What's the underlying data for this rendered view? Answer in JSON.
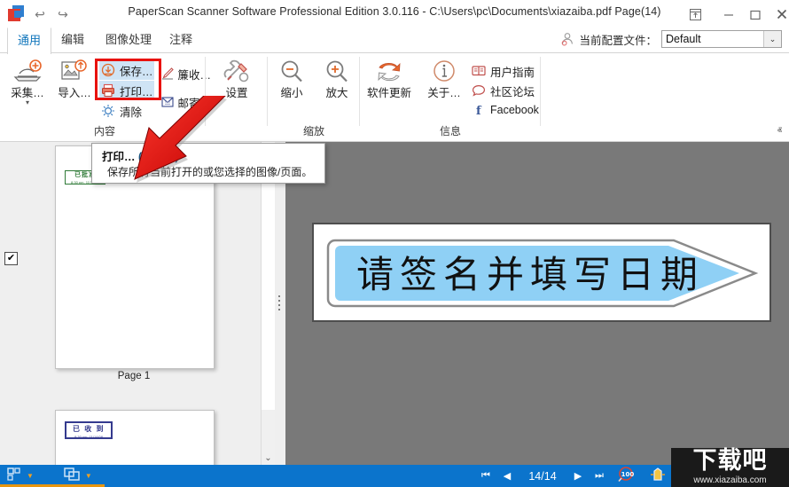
{
  "window": {
    "title": "PaperScan Scanner Software Professional Edition 3.0.116 - C:\\Users\\pc\\Documents\\xiazaiba.pdf Page(14)",
    "app_icon": "paperscan-logo",
    "quick_access": [
      {
        "name": "undo",
        "glyph": "↩"
      },
      {
        "name": "redo",
        "glyph": "↪"
      }
    ],
    "controls": {
      "ribbon_options": "⤒",
      "minimize": "–",
      "maximize": "☐",
      "close": "✕"
    }
  },
  "tabs": [
    {
      "label": "通用",
      "active": true
    },
    {
      "label": "编辑",
      "active": false
    },
    {
      "label": "图像处理",
      "active": false
    },
    {
      "label": "注释",
      "active": false
    }
  ],
  "profile": {
    "icon": "user-profile-icon",
    "label": "当前配置文件：",
    "value": "Default",
    "dropdown_glyph": "⌄"
  },
  "ribbon": {
    "collapse_glyph": "ⱏ",
    "groups": [
      {
        "name": "content",
        "label": "内容",
        "big_buttons": [
          {
            "name": "acquire",
            "label": "采集…",
            "icon": "scanner-plus-icon",
            "has_menu": true
          },
          {
            "name": "import",
            "label": "导入…",
            "icon": "import-image-icon",
            "has_menu": false
          }
        ],
        "small_buttons": [
          {
            "name": "save",
            "label": "保存…",
            "icon": "save-down-arrow-icon",
            "highlighted": false
          },
          {
            "name": "print",
            "label": "打印…",
            "icon": "printer-icon",
            "highlighted": true
          },
          {
            "name": "clear",
            "label": "清除",
            "icon": "clear-icon",
            "highlighted": false
          },
          {
            "name": "sign",
            "label": "簾收…",
            "icon": "pen-sign-icon",
            "highlighted": false
          },
          {
            "name": "mail",
            "label": "邮寄…",
            "icon": "mail-icon",
            "highlighted": false
          }
        ]
      },
      {
        "name": "settings",
        "label": "",
        "big_buttons": [
          {
            "name": "settings",
            "label": "设置",
            "icon": "wrench-screwdriver-icon",
            "has_menu": false
          }
        ],
        "small_buttons": []
      },
      {
        "name": "zoom",
        "label": "缩放",
        "big_buttons": [
          {
            "name": "zoom-out",
            "label": "缩小",
            "icon": "magnifier-minus-icon",
            "has_menu": false
          },
          {
            "name": "zoom-in",
            "label": "放大",
            "icon": "magnifier-plus-icon",
            "has_menu": false
          }
        ],
        "small_buttons": []
      },
      {
        "name": "info",
        "label": "信息",
        "big_buttons": [
          {
            "name": "software-update",
            "label": "软件更新",
            "icon": "refresh-arrows-icon",
            "has_menu": false
          },
          {
            "name": "about",
            "label": "关于…",
            "icon": "info-circle-icon",
            "has_menu": false
          }
        ],
        "small_buttons": [
          {
            "name": "user-guide",
            "label": "用户指南",
            "icon": "book-icon",
            "highlighted": false
          },
          {
            "name": "community-forum",
            "label": "社区论坛",
            "icon": "speech-bubble-icon",
            "highlighted": false
          },
          {
            "name": "facebook",
            "label": "Facebook",
            "icon": "facebook-icon",
            "highlighted": false
          }
        ]
      }
    ]
  },
  "tooltip": {
    "title": "打印…",
    "shortcut": "(Ctrl+P)",
    "body": "保存所有当前打开的或您选择的图像/页面。"
  },
  "thumbnails": {
    "checkbox_checked": "✔",
    "items": [
      {
        "name": "page-1-thumbnail",
        "label": "Page 1",
        "stamp": {
          "text": "已批准",
          "sub": "8:30 pm, 11/14/08",
          "color": "#2f7a37"
        }
      },
      {
        "name": "page-2-thumbnail",
        "label": "",
        "stamp": {
          "text": "已 收 到",
          "sub": "8:30 pm, 11/14/08",
          "color": "#343a8e"
        }
      }
    ],
    "scroll_down_glyph": "⌄"
  },
  "document": {
    "arrow_text": "请签名并填写日期",
    "arrow_fill": "#8fd0f5",
    "page_background": "#ffffff",
    "canvas_background": "#797979"
  },
  "statusbar": {
    "background": "#0b74cc",
    "tools": [
      {
        "name": "page-layout-tool",
        "icon": "layout-grid-icon",
        "caret": "▼"
      },
      {
        "name": "view-mode-tool",
        "icon": "overlap-windows-icon",
        "caret": "▼"
      }
    ],
    "nav": {
      "first": "⏮",
      "prev": "◀",
      "page": "14/14",
      "next": "▶",
      "last": "⏭"
    },
    "zoom_icon": "zoom-100-icon",
    "zoom_value": "100",
    "fit_icon": "fit-page-icon"
  },
  "watermark": {
    "text": "下载吧",
    "url": "www.xiazaiba.com"
  }
}
